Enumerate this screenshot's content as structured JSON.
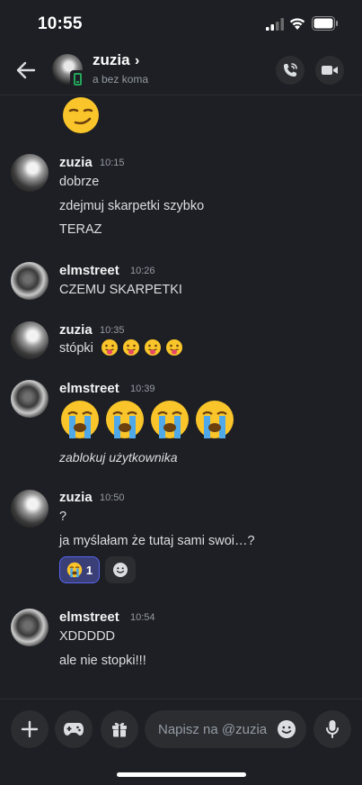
{
  "status_bar": {
    "time": "10:55"
  },
  "header": {
    "name": "zuzia",
    "chevron": "›",
    "subtitle": "a bez koma",
    "icons": [
      "back-arrow-icon",
      "phone-call-icon",
      "video-camera-icon"
    ]
  },
  "messages": [
    {
      "author": "zuzia",
      "time": "10:15",
      "lines": [
        "dobrze",
        "zdejmuj skarpetki szybko",
        "TERAZ"
      ]
    },
    {
      "author": "elmstreet",
      "time": "10:26",
      "lines": [
        "CZEMU SKARPETKI"
      ]
    },
    {
      "author": "zuzia",
      "time": "10:35",
      "lines": [
        "stópki"
      ],
      "emoji": [
        "😛",
        "😛",
        "😛",
        "😛"
      ]
    },
    {
      "author": "elmstreet",
      "time": "10:39",
      "big_emoji": [
        "😭",
        "😭",
        "😭",
        "😭"
      ],
      "lines": [
        "zablokuj użytkownika"
      ]
    },
    {
      "author": "zuzia",
      "time": "10:50",
      "lines": [
        "?",
        "ja myślałam że tutaj sami swoi…?"
      ],
      "reaction": {
        "emoji": "😭",
        "count": "1"
      }
    },
    {
      "author": "elmstreet",
      "time": "10:54",
      "lines": [
        "XDDDDD",
        "ale nie stopki!!!"
      ]
    }
  ],
  "top_emoji": "😏",
  "composer": {
    "placeholder": "Napisz na @zuzia",
    "icons": [
      "plus-icon",
      "gamepad-icon",
      "gift-icon",
      "emoji-smile-icon",
      "microphone-icon"
    ]
  },
  "colors": {
    "background": "#1e1f24",
    "surface": "#2b2d31",
    "accent": "#5865f2",
    "online": "#23a55a"
  }
}
